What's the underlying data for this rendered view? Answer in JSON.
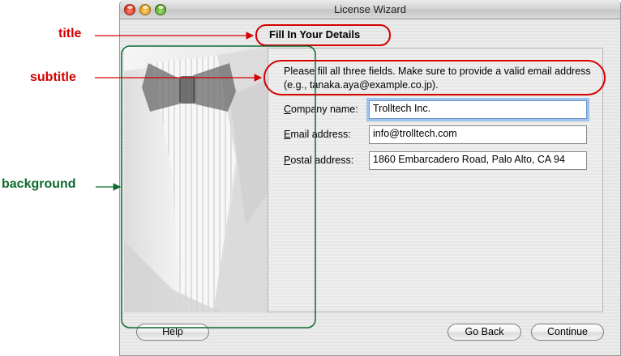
{
  "annotations": {
    "title": "title",
    "subtitle": "subtitle",
    "background": "background"
  },
  "window": {
    "title": "License Wizard"
  },
  "page": {
    "title": "Fill In Your Details",
    "subtitle": "Please fill all three fields. Make sure to provide a valid email address (e.g., tanaka.aya@example.co.jp)."
  },
  "fields": {
    "company": {
      "mnemonic": "C",
      "label_rest": "ompany name:",
      "value": "Trolltech Inc."
    },
    "email": {
      "mnemonic": "E",
      "label_rest": "mail address:",
      "value": "info@trolltech.com"
    },
    "postal": {
      "mnemonic": "P",
      "label_rest": "ostal address:",
      "value": "1860 Embarcadero Road, Palo Alto, CA 94"
    }
  },
  "buttons": {
    "help": "Help",
    "back": "Go Back",
    "continue": "Continue"
  },
  "colors": {
    "annotation_red": "#d40000",
    "annotation_green": "#0e6b2e",
    "focus_ring": "#9ec3ee"
  }
}
